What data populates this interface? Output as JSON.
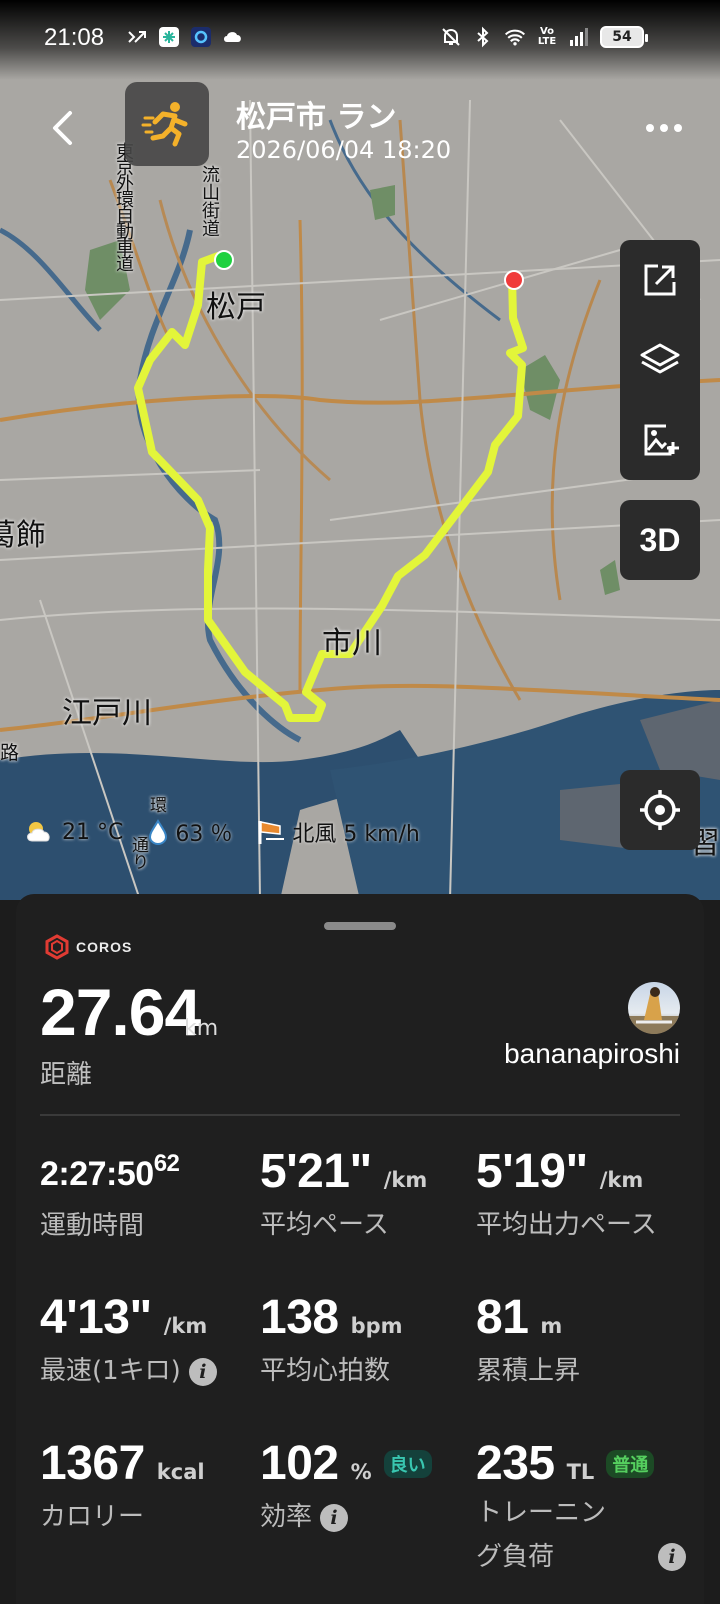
{
  "status_bar": {
    "time": "21:08",
    "battery": "54",
    "network": "LTE",
    "network_top": "Vo"
  },
  "header": {
    "title": "松戸市 ラン",
    "datetime": "2026/06/04 18:20",
    "activity_icon": "running-person-icon",
    "accent_color": "#f4b12a"
  },
  "map": {
    "labels": {
      "matsudo": "松戸",
      "ichikawa": "市川",
      "edogawa": "江戸川",
      "katsushika": "葛飾",
      "narashino": "習",
      "gaikan": "東京外環自動車道",
      "nagareyama": "流山街道",
      "kan": "環",
      "dori": "通り",
      "ro": "路"
    },
    "route_color": "#e3f53a",
    "start_color": "#1fd140",
    "end_color": "#f03b3b",
    "tools": [
      "share-icon",
      "layers-icon",
      "add-image-icon"
    ],
    "tool_3d": "3D"
  },
  "weather": {
    "temp": "21 °C",
    "humidity": "63 ％",
    "wind": "北風 5 km/h"
  },
  "panel": {
    "brand": "COROS",
    "distance": "27.64",
    "distance_unit": "km",
    "distance_label": "距離",
    "username": "bananapiroshi",
    "metrics": [
      {
        "value": "2:27:50",
        "sup": "62",
        "unit": "",
        "label": "運動時間"
      },
      {
        "value": "5'21\"",
        "unit": "/km",
        "label": "平均ペース"
      },
      {
        "value": "5'19\"",
        "unit": "/km",
        "label": "平均出力ペース"
      },
      {
        "value": "4'13\"",
        "unit": "/km",
        "label": "最速(1キロ)"
      },
      {
        "value": "138",
        "unit": "bpm",
        "label": "平均心拍数"
      },
      {
        "value": "81",
        "unit": "m",
        "label": "累積上昇"
      },
      {
        "value": "1367",
        "unit": "kcal",
        "label": "カロリー"
      },
      {
        "value": "102",
        "unit": "%",
        "badge": "良い",
        "label": "効率"
      },
      {
        "value": "235",
        "unit": "TL",
        "badge": "普通",
        "label": "トレーニング負荷",
        "label_line1": "トレーニン",
        "label_line2": "グ負荷"
      }
    ]
  }
}
